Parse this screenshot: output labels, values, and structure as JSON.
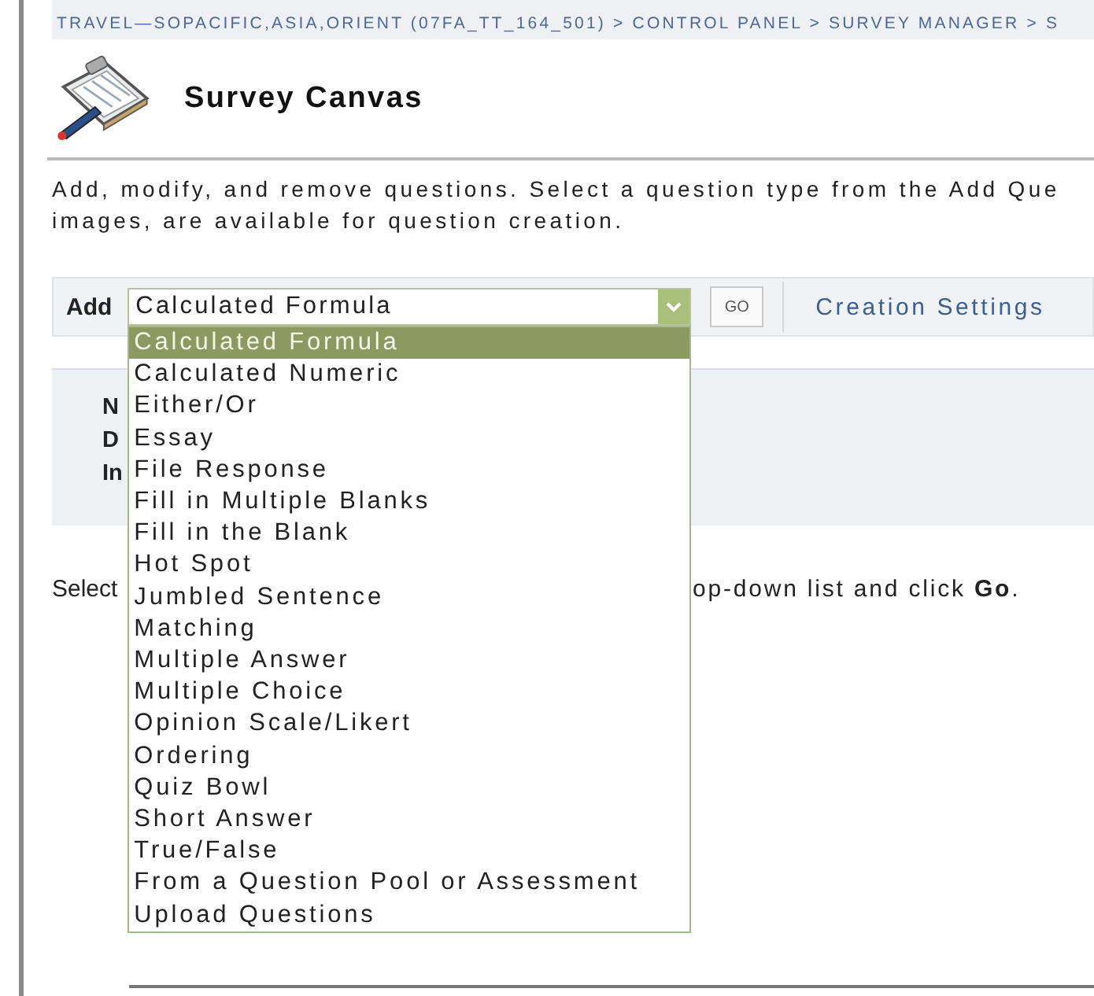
{
  "breadcrumb": "TRAVEL—SOPACIFIC,ASIA,ORIENT (07FA_TT_164_501) > CONTROL PANEL > SURVEY MANAGER > S",
  "page": {
    "title": "Survey Canvas"
  },
  "description": [
    "Add, modify, and remove questions. Select a question type from the Add Que",
    "images, are available for question creation."
  ],
  "toolbar": {
    "add_label": "Add",
    "select": {
      "value": "Calculated Formula",
      "expanded": true,
      "options": [
        {
          "label": "Calculated Formula",
          "selected": true
        },
        {
          "label": "Calculated Numeric",
          "selected": false
        },
        {
          "label": "Either/Or",
          "selected": false
        },
        {
          "label": "Essay",
          "selected": false
        },
        {
          "label": "File Response",
          "selected": false
        },
        {
          "label": "Fill in Multiple Blanks",
          "selected": false
        },
        {
          "label": "Fill in the Blank",
          "selected": false
        },
        {
          "label": "Hot Spot",
          "selected": false
        },
        {
          "label": "Jumbled Sentence",
          "selected": false
        },
        {
          "label": "Matching",
          "selected": false
        },
        {
          "label": "Multiple Answer",
          "selected": false
        },
        {
          "label": "Multiple Choice",
          "selected": false
        },
        {
          "label": "Opinion Scale/Likert",
          "selected": false
        },
        {
          "label": "Ordering",
          "selected": false
        },
        {
          "label": "Quiz Bowl",
          "selected": false
        },
        {
          "label": "Short Answer",
          "selected": false
        },
        {
          "label": "True/False",
          "selected": false
        },
        {
          "label": "From a Question Pool or Assessment",
          "selected": false
        },
        {
          "label": "Upload Questions",
          "selected": false
        }
      ]
    },
    "go_button": "GO",
    "link": "Creation Settings"
  },
  "info_panel": {
    "labels": [
      "N",
      "D",
      "In"
    ]
  },
  "instruction": {
    "left": "Select",
    "right": "op-down list and click **Go**."
  }
}
